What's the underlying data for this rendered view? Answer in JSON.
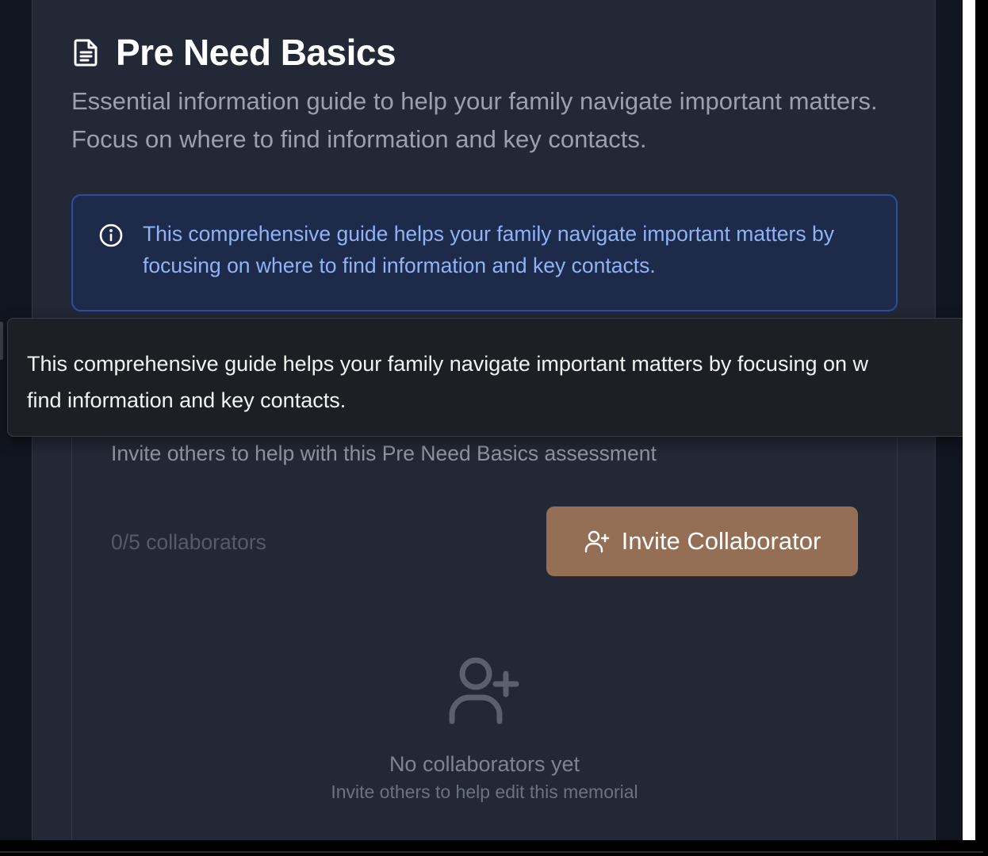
{
  "page": {
    "title": "Pre Need Basics",
    "title_icon": "document-text-icon",
    "subtitle": "Essential information guide to help your family navigate important matters. Focus on where to find information and key contacts."
  },
  "info_box": {
    "icon": "info-circle-icon",
    "text": "This comprehensive guide helps your family navigate important matters by focusing on where to find information and key contacts."
  },
  "tooltip": {
    "line1": "This comprehensive guide helps your family navigate important matters by focusing on w",
    "line2": "find information and key contacts."
  },
  "collaborators": {
    "description": "Invite others to help with this Pre Need Basics assessment",
    "count_text": "0/5 collaborators",
    "invite_button_label": "Invite Collaborator",
    "invite_button_icon": "user-plus-icon",
    "empty_icon": "user-plus-icon",
    "empty_title": "No collaborators yet",
    "empty_subtitle": "Invite others to help edit this memorial"
  },
  "colors": {
    "background": "#111520",
    "card": "#222836",
    "info_box_bg": "#1e2a4a",
    "info_box_border": "#2e4ea3",
    "info_text": "#8fb3f5",
    "accent_button": "#946f56",
    "tooltip_bg": "#1e1f24"
  }
}
